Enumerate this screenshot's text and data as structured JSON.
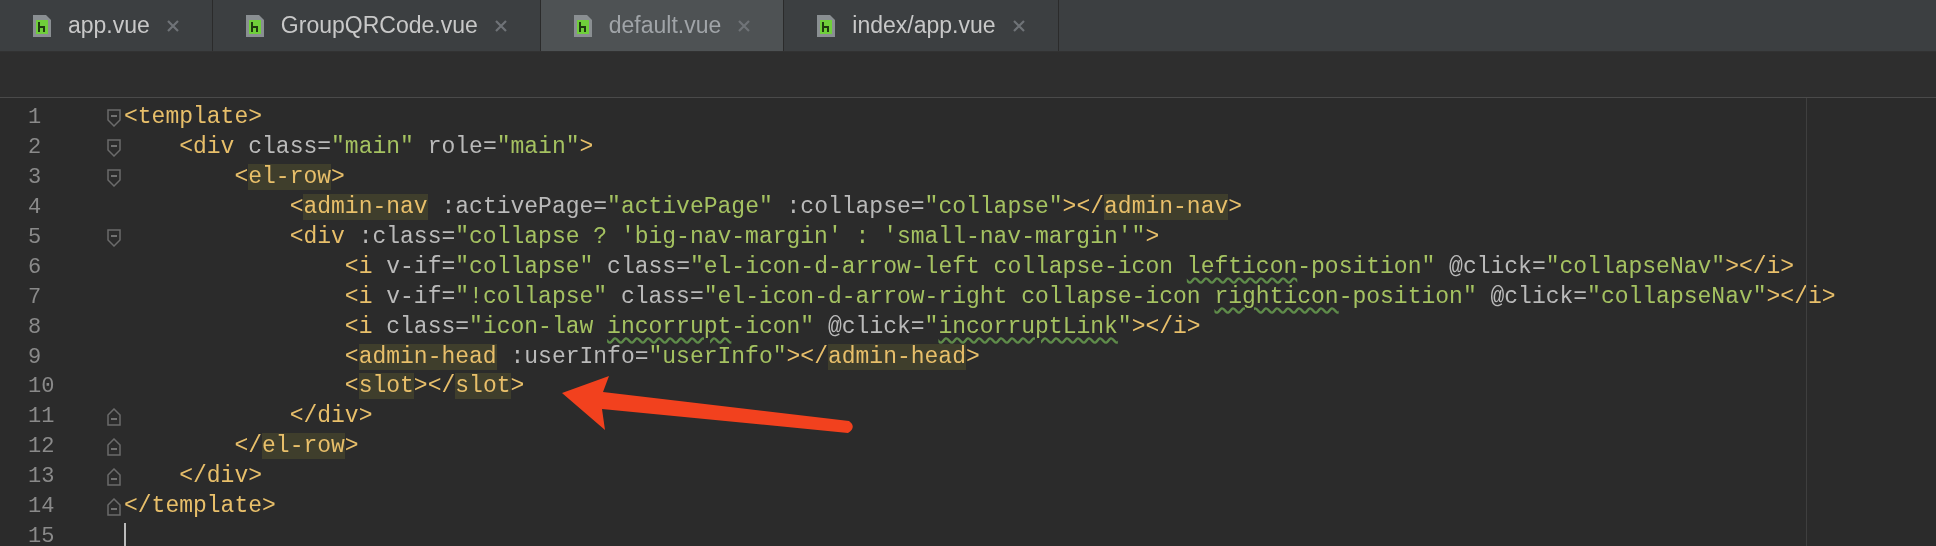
{
  "tabs": [
    {
      "label": "app.vue",
      "selected": false
    },
    {
      "label": "GroupQRCode.vue",
      "selected": false
    },
    {
      "label": "default.vue",
      "selected": true
    },
    {
      "label": "index/app.vue",
      "selected": false
    }
  ],
  "editor": {
    "lines": [
      {
        "number": "1",
        "fold_start": true,
        "fold_end": false,
        "cursor": false,
        "tokens": [
          {
            "kind": "tag",
            "text": "<template>"
          }
        ]
      },
      {
        "number": "2",
        "fold_start": true,
        "fold_end": false,
        "cursor": false,
        "tokens": [
          {
            "kind": "tag",
            "text": "    <div"
          },
          {
            "kind": "attr",
            "text": " class="
          },
          {
            "kind": "value",
            "text": "\"main\""
          },
          {
            "kind": "attr",
            "text": " role="
          },
          {
            "kind": "value",
            "text": "\"main\""
          },
          {
            "kind": "tag",
            "text": ">"
          }
        ]
      },
      {
        "number": "3",
        "fold_start": true,
        "fold_end": false,
        "cursor": false,
        "tokens": [
          {
            "kind": "tag",
            "text": "        <"
          },
          {
            "kind": "match",
            "text": "el-row"
          },
          {
            "kind": "tag",
            "text": ">"
          }
        ]
      },
      {
        "number": "4",
        "fold_start": false,
        "fold_end": false,
        "cursor": false,
        "tokens": [
          {
            "kind": "tag",
            "text": "            <"
          },
          {
            "kind": "match",
            "text": "admin-nav"
          },
          {
            "kind": "attr",
            "text": " :activePage="
          },
          {
            "kind": "value",
            "text": "\"activePage\""
          },
          {
            "kind": "attr",
            "text": " :collapse="
          },
          {
            "kind": "value",
            "text": "\"collapse\""
          },
          {
            "kind": "tag",
            "text": "></"
          },
          {
            "kind": "match",
            "text": "admin-nav"
          },
          {
            "kind": "tag",
            "text": ">"
          }
        ]
      },
      {
        "number": "5",
        "fold_start": true,
        "fold_end": false,
        "cursor": false,
        "tokens": [
          {
            "kind": "tag",
            "text": "            <div"
          },
          {
            "kind": "attr",
            "text": " :class="
          },
          {
            "kind": "value",
            "text": "\"collapse ? 'big-nav-margin' : 'small-nav-margin'\""
          },
          {
            "kind": "tag",
            "text": ">"
          }
        ]
      },
      {
        "number": "6",
        "fold_start": false,
        "fold_end": false,
        "cursor": false,
        "tokens": [
          {
            "kind": "tag",
            "text": "                <i"
          },
          {
            "kind": "attr",
            "text": " v-if="
          },
          {
            "kind": "value",
            "text": "\"collapse\""
          },
          {
            "kind": "attr",
            "text": " class="
          },
          {
            "kind": "value",
            "text": "\"el-icon-d-arrow-left collapse-icon "
          },
          {
            "kind": "typo",
            "text": "lefticon"
          },
          {
            "kind": "value",
            "text": "-position\""
          },
          {
            "kind": "attr",
            "text": " @click="
          },
          {
            "kind": "value",
            "text": "\"collapseNav\""
          },
          {
            "kind": "tag",
            "text": "></i>"
          }
        ]
      },
      {
        "number": "7",
        "fold_start": false,
        "fold_end": false,
        "cursor": false,
        "tokens": [
          {
            "kind": "tag",
            "text": "                <i"
          },
          {
            "kind": "attr",
            "text": " v-if="
          },
          {
            "kind": "value",
            "text": "\"!collapse\""
          },
          {
            "kind": "attr",
            "text": " class="
          },
          {
            "kind": "value",
            "text": "\"el-icon-d-arrow-right collapse-icon "
          },
          {
            "kind": "typo",
            "text": "righticon"
          },
          {
            "kind": "value",
            "text": "-position\""
          },
          {
            "kind": "attr",
            "text": " @click="
          },
          {
            "kind": "value",
            "text": "\"collapseNav\""
          },
          {
            "kind": "tag",
            "text": "></i>"
          }
        ]
      },
      {
        "number": "8",
        "fold_start": false,
        "fold_end": false,
        "cursor": false,
        "tokens": [
          {
            "kind": "tag",
            "text": "                <i"
          },
          {
            "kind": "attr",
            "text": " class="
          },
          {
            "kind": "value",
            "text": "\"icon-law "
          },
          {
            "kind": "typo",
            "text": "incorrupt"
          },
          {
            "kind": "value",
            "text": "-icon\""
          },
          {
            "kind": "attr",
            "text": " @click="
          },
          {
            "kind": "value",
            "text": "\""
          },
          {
            "kind": "typo",
            "text": "incorruptLink"
          },
          {
            "kind": "value",
            "text": "\""
          },
          {
            "kind": "tag",
            "text": "></i>"
          }
        ]
      },
      {
        "number": "9",
        "fold_start": false,
        "fold_end": false,
        "cursor": false,
        "tokens": [
          {
            "kind": "tag",
            "text": "                <"
          },
          {
            "kind": "match",
            "text": "admin-head"
          },
          {
            "kind": "attr",
            "text": " :userInfo="
          },
          {
            "kind": "value",
            "text": "\"userInfo\""
          },
          {
            "kind": "tag",
            "text": "></"
          },
          {
            "kind": "match",
            "text": "admin-head"
          },
          {
            "kind": "tag",
            "text": ">"
          }
        ]
      },
      {
        "number": "10",
        "fold_start": false,
        "fold_end": false,
        "cursor": false,
        "tokens": [
          {
            "kind": "tag",
            "text": "                <"
          },
          {
            "kind": "match",
            "text": "slot"
          },
          {
            "kind": "tag",
            "text": "></"
          },
          {
            "kind": "match",
            "text": "slot"
          },
          {
            "kind": "tag",
            "text": ">"
          }
        ]
      },
      {
        "number": "11",
        "fold_start": false,
        "fold_end": true,
        "cursor": false,
        "tokens": [
          {
            "kind": "tag",
            "text": "            </div>"
          }
        ]
      },
      {
        "number": "12",
        "fold_start": false,
        "fold_end": true,
        "cursor": false,
        "tokens": [
          {
            "kind": "tag",
            "text": "        </"
          },
          {
            "kind": "match",
            "text": "el-row"
          },
          {
            "kind": "tag",
            "text": ">"
          }
        ]
      },
      {
        "number": "13",
        "fold_start": false,
        "fold_end": true,
        "cursor": false,
        "tokens": [
          {
            "kind": "tag",
            "text": "    </div>"
          }
        ]
      },
      {
        "number": "14",
        "fold_start": false,
        "fold_end": true,
        "cursor": false,
        "tokens": [
          {
            "kind": "tag",
            "text": "</template>"
          }
        ]
      },
      {
        "number": "15",
        "fold_start": false,
        "fold_end": false,
        "cursor": true
      }
    ]
  }
}
